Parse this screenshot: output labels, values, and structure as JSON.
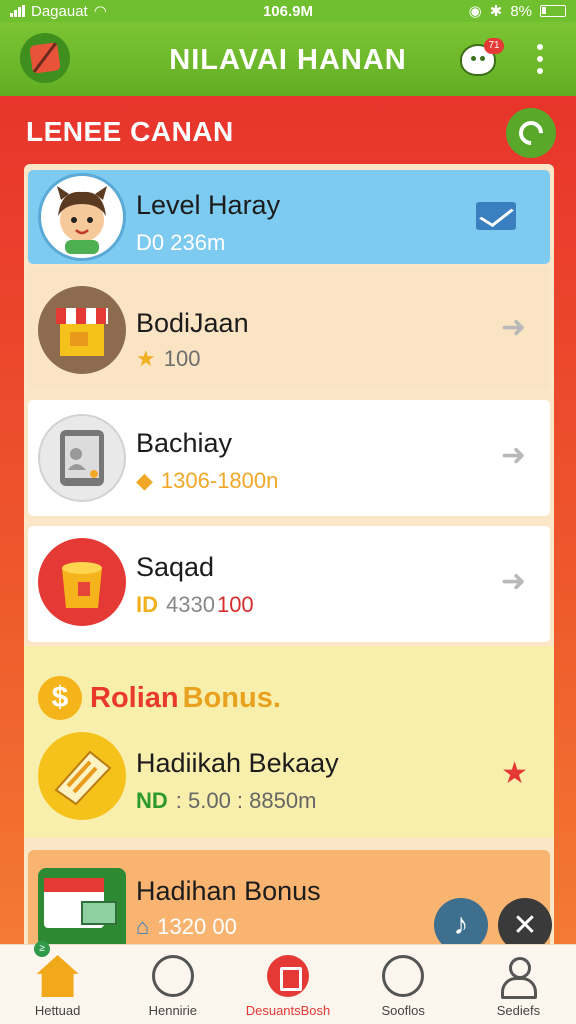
{
  "status_bar": {
    "carrier": "Dagauat",
    "time": "106.9M",
    "battery": "8%"
  },
  "app_bar": {
    "title": "NILAVAI HANAN",
    "chat_badge": "71"
  },
  "section": {
    "title": "LENEE CANAN"
  },
  "cards": [
    {
      "title": "Level Haray",
      "sub": "D0 236m"
    },
    {
      "title": "BodiJaan",
      "sub": "100"
    },
    {
      "title": "Bachiay",
      "sub": "1306-1800n"
    },
    {
      "title": "Saqad",
      "sub_a": "ID",
      "sub_b": "4330",
      "sub_c": "100"
    }
  ],
  "bonus": {
    "title_a": "Rolian",
    "title_b": "Bonus.",
    "coin": "$"
  },
  "bonus_cards": [
    {
      "title": "Hadiikah Bekaay",
      "sub_a": "ND",
      "sub_b": ": 5.00 : 8850m"
    },
    {
      "title": "Hadihan Bonus",
      "sub": "1320 00"
    }
  ],
  "bottom_nav": [
    {
      "label": "Hettuad",
      "badge": "≥"
    },
    {
      "label": "Hennirie"
    },
    {
      "label": "DesuantsBosh"
    },
    {
      "label": "Sooflos"
    },
    {
      "label": "Sediefs"
    }
  ],
  "colors": {
    "accent_green": "#6fbf2e",
    "accent_red": "#e53935",
    "card_blue": "#7dcbf0"
  }
}
